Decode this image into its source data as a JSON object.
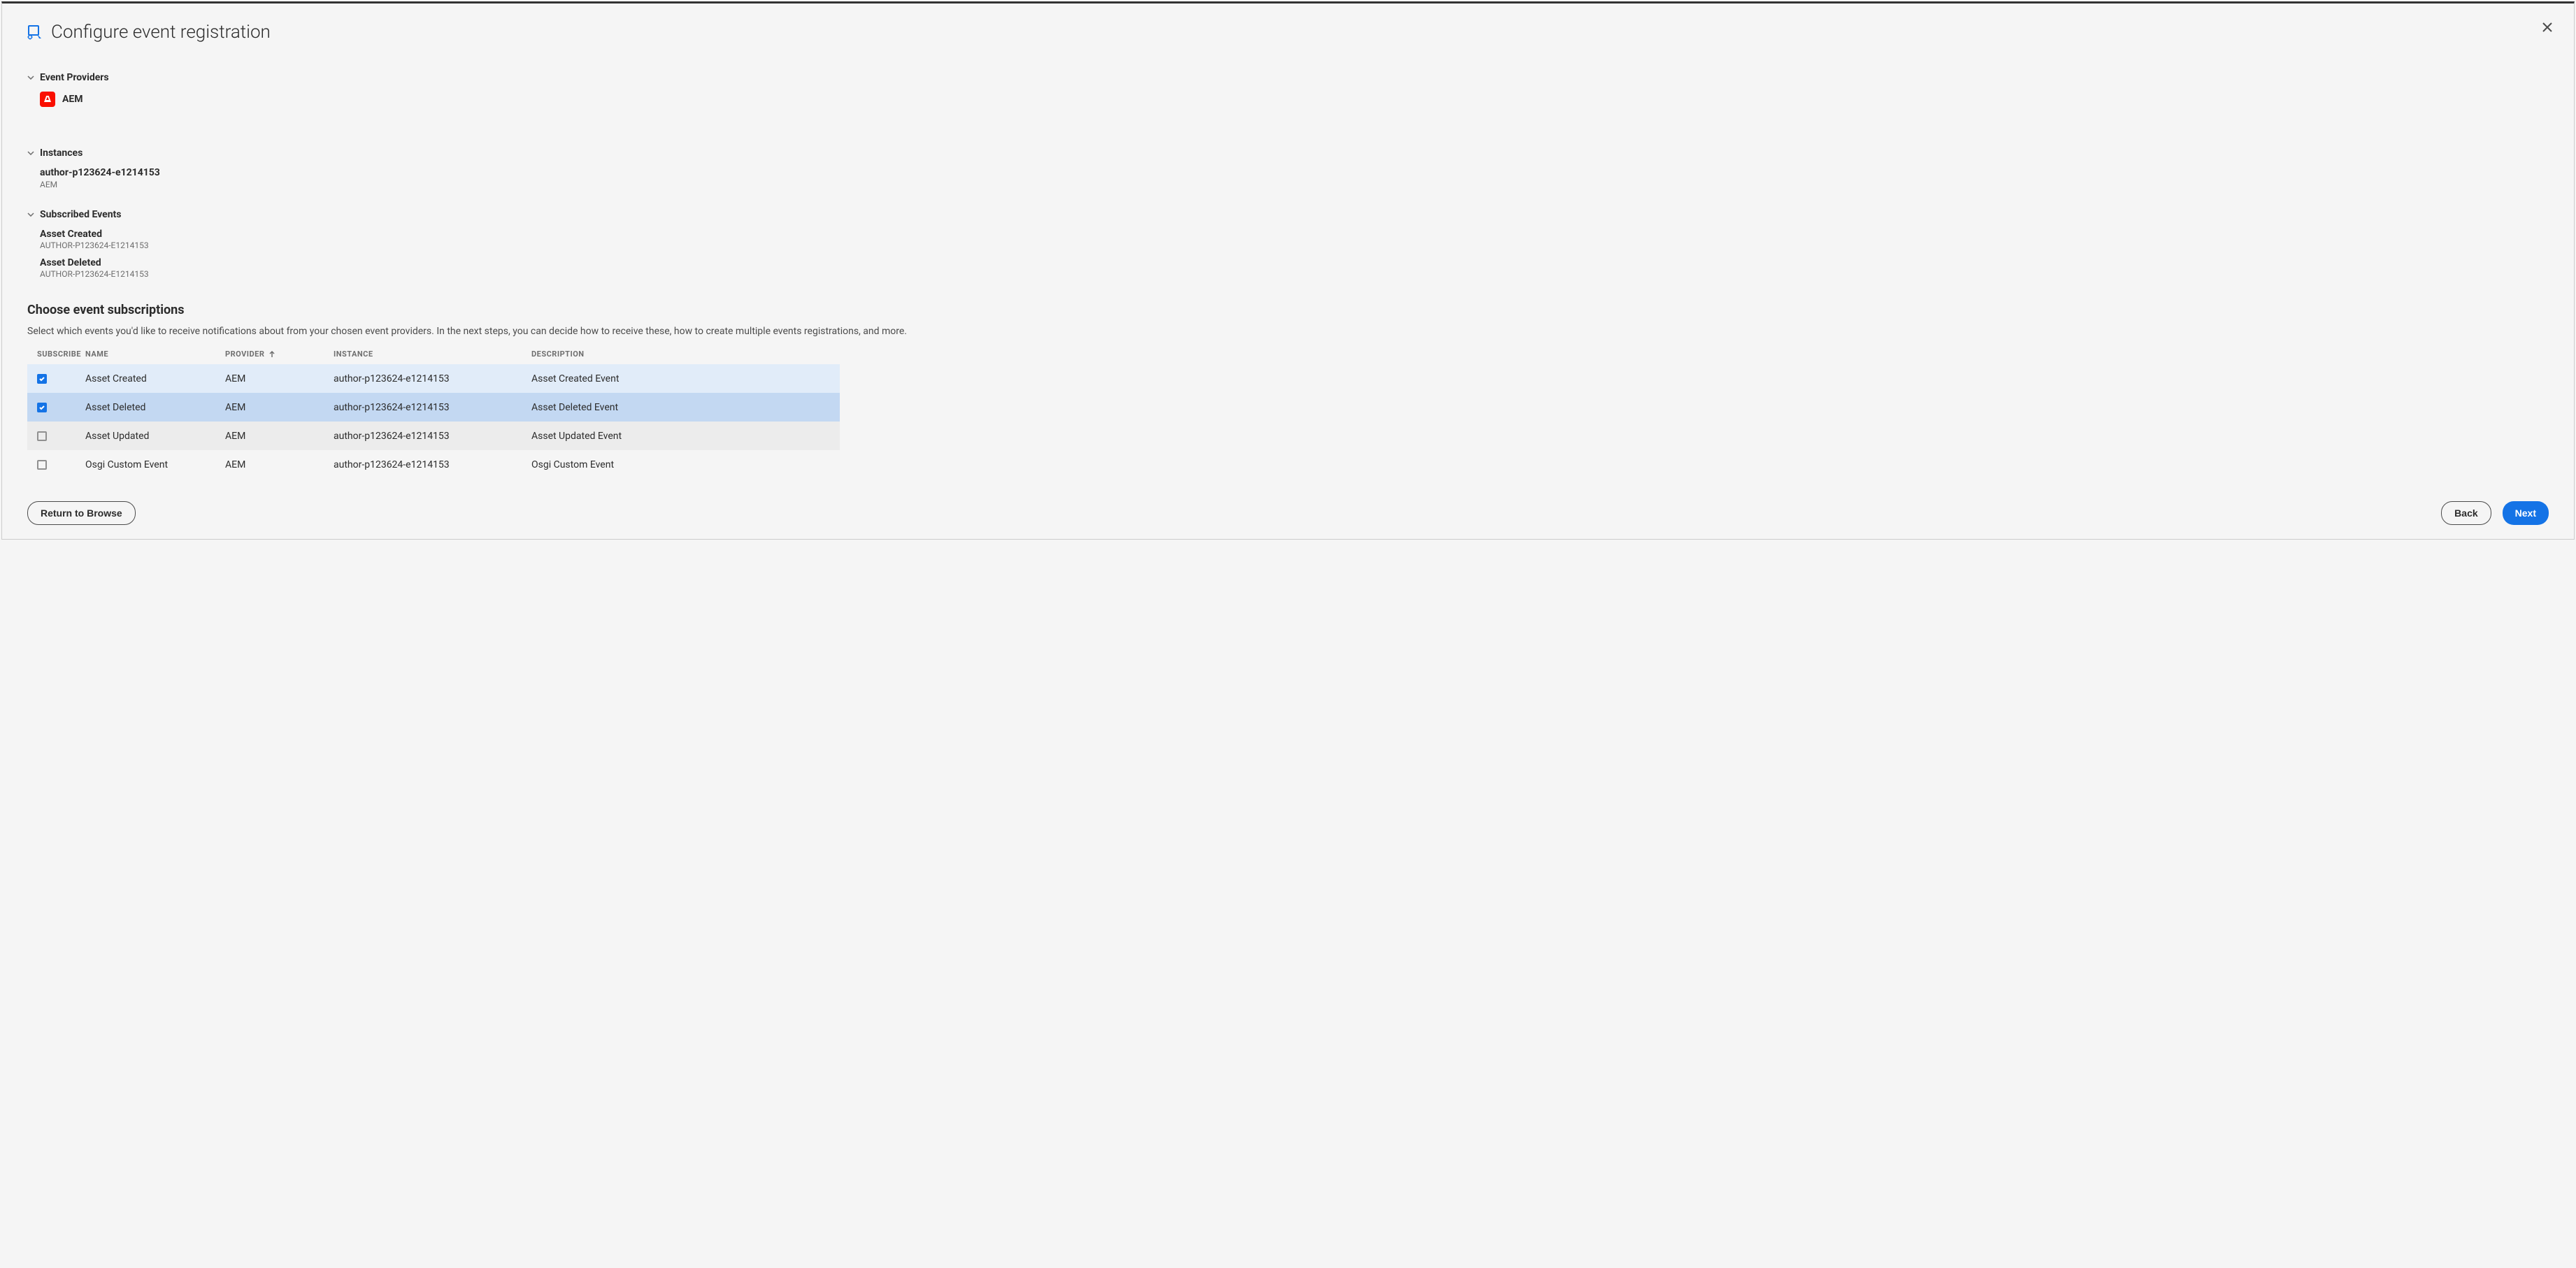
{
  "header": {
    "title": "Configure event registration"
  },
  "sections": {
    "eventProviders": {
      "title": "Event Providers",
      "provider": {
        "name": "AEM"
      }
    },
    "instances": {
      "title": "Instances",
      "item": {
        "name": "author-p123624-e1214153",
        "sub": "AEM"
      }
    },
    "subscribedEvents": {
      "title": "Subscribed Events",
      "items": [
        {
          "name": "Asset Created",
          "sub": "AUTHOR-P123624-E1214153"
        },
        {
          "name": "Asset Deleted",
          "sub": "AUTHOR-P123624-E1214153"
        }
      ]
    }
  },
  "choose": {
    "title": "Choose event subscriptions",
    "description": "Select which events you'd like to receive notifications about from your chosen event providers. In the next steps, you can decide how to receive these, how to create multiple events registrations, and more."
  },
  "table": {
    "headers": {
      "subscribe": "SUBSCRIBE",
      "name": "NAME",
      "provider": "PROVIDER",
      "instance": "INSTANCE",
      "description": "DESCRIPTION"
    },
    "rows": [
      {
        "checked": true,
        "name": "Asset Created",
        "provider": "AEM",
        "instance": "author-p123624-e1214153",
        "description": "Asset Created Event"
      },
      {
        "checked": true,
        "name": "Asset Deleted",
        "provider": "AEM",
        "instance": "author-p123624-e1214153",
        "description": "Asset Deleted Event"
      },
      {
        "checked": false,
        "name": "Asset Updated",
        "provider": "AEM",
        "instance": "author-p123624-e1214153",
        "description": "Asset Updated Event"
      },
      {
        "checked": false,
        "name": "Osgi Custom Event",
        "provider": "AEM",
        "instance": "author-p123624-e1214153",
        "description": "Osgi Custom Event"
      }
    ]
  },
  "footer": {
    "returnBrowse": "Return to Browse",
    "back": "Back",
    "next": "Next"
  }
}
